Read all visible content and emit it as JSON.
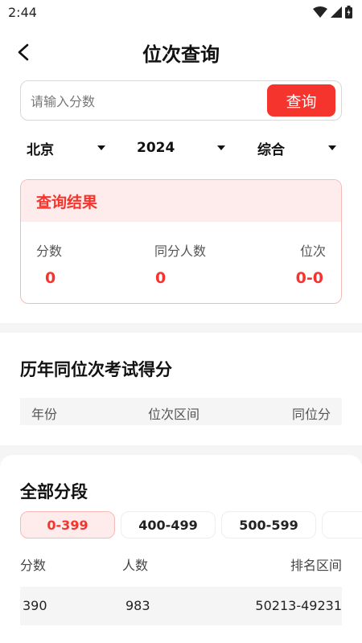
{
  "status": {
    "time": "2:44"
  },
  "nav": {
    "title": "位次查询"
  },
  "search": {
    "placeholder": "请输入分数",
    "value": "",
    "button_label": "查询"
  },
  "filters": {
    "region": "北京",
    "year": "2024",
    "subject": "综合"
  },
  "result": {
    "title": "查询结果",
    "columns": [
      {
        "label": "分数",
        "value": "0"
      },
      {
        "label": "同分人数",
        "value": "0"
      },
      {
        "label": "位次",
        "value": "0-0"
      }
    ]
  },
  "history": {
    "title": "历年同位次考试得分",
    "headers": [
      "年份",
      "位次区间",
      "同位分"
    ]
  },
  "segments": {
    "title": "全部分段",
    "tabs": [
      "0-399",
      "400-499",
      "500-599"
    ],
    "active_tab": 0,
    "headers": [
      "分数",
      "人数",
      "排名区间"
    ],
    "rows": [
      {
        "score": "390",
        "count": "983",
        "range": "50213-49231"
      }
    ]
  },
  "colors": {
    "accent": "#f5342d",
    "accent_light": "#fdeceb",
    "border_accent": "#f6b9b6"
  }
}
